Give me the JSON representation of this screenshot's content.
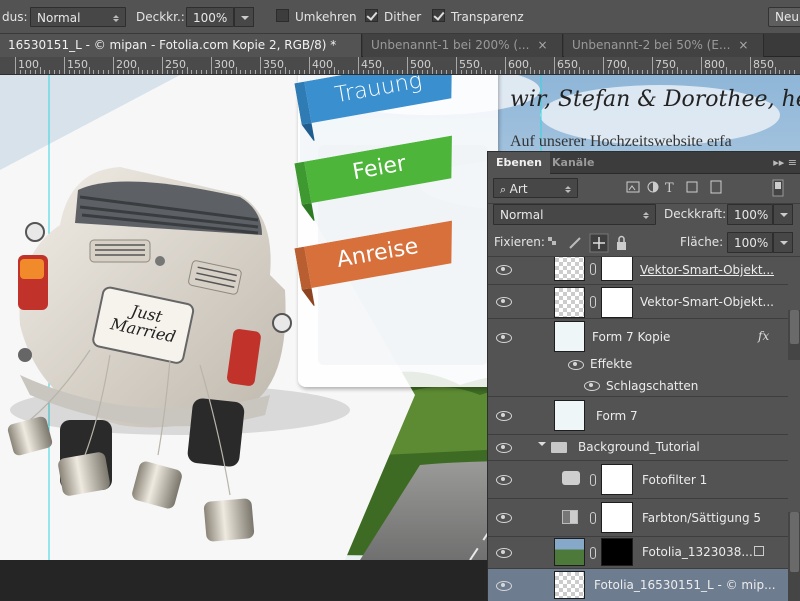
{
  "options_bar": {
    "mode_label": "dus:",
    "mode_value": "Normal",
    "opacity_label": "Deckkr.:",
    "opacity_value": "100%",
    "reverse_label": "Umkehren",
    "reverse_checked": false,
    "dither_label": "Dither",
    "dither_checked": true,
    "transparency_label": "Transparenz",
    "transparency_checked": true,
    "new_button_label": "Neu"
  },
  "document_tabs": [
    {
      "label": "16530151_L - © mipan - Fotolia.com Kopie 2, RGB/8) *",
      "active": true
    },
    {
      "label": "Unbenannt-1 bei 200% (...",
      "active": false
    },
    {
      "label": "Unbenannt-2 bei 50% (E...",
      "active": false
    }
  ],
  "ruler": {
    "labels": [
      "100",
      "150",
      "200",
      "250",
      "300",
      "350",
      "400",
      "450",
      "500",
      "550",
      "600",
      "650",
      "700",
      "750",
      "800",
      "850"
    ]
  },
  "canvas": {
    "ribbons": [
      {
        "label": "Trauung",
        "color": "#3a8fcf"
      },
      {
        "label": "Feier",
        "color": "#4cb53a"
      },
      {
        "label": "Anreise",
        "color": "#d8703c"
      }
    ],
    "heading": "wir, Stefan & Dorothee, he",
    "subheading": "Auf unserer Hochzeitswebsite erfa",
    "plate_line1": "Just",
    "plate_line2": "Married"
  },
  "layers_panel": {
    "tabs": [
      {
        "label": "Ebenen",
        "active": true
      },
      {
        "label": "Kanäle",
        "active": false
      }
    ],
    "filter_type": "Art",
    "blend_mode": "Normal",
    "opacity_label": "Deckkraft:",
    "opacity_value": "100%",
    "lock_label": "Fixieren:",
    "fill_label": "Fläche:",
    "fill_value": "100%",
    "layers": [
      {
        "name": "Vektor-Smart-Objekt...",
        "kind": "smart",
        "selected": false
      },
      {
        "name": "Vektor-Smart-Objekt...",
        "kind": "smart",
        "selected": false
      },
      {
        "name": "Form 7 Kopie",
        "kind": "shape",
        "fx": "fx",
        "selected": false
      },
      {
        "name": "Effekte",
        "kind": "effects"
      },
      {
        "name": "Schlagschatten",
        "kind": "effect"
      },
      {
        "name": "Form 7",
        "kind": "shape",
        "selected": false
      },
      {
        "name": "Background_Tutorial",
        "kind": "group",
        "selected": false
      },
      {
        "name": "Fotofilter 1",
        "kind": "adjust",
        "selected": false
      },
      {
        "name": "Farbton/Sättigung 5",
        "kind": "adjust",
        "selected": false
      },
      {
        "name": "Fotolia_1323038...",
        "kind": "photo",
        "selected": false
      },
      {
        "name": "Fotolia_16530151_L - © mip...",
        "kind": "photo",
        "selected": true
      }
    ]
  }
}
